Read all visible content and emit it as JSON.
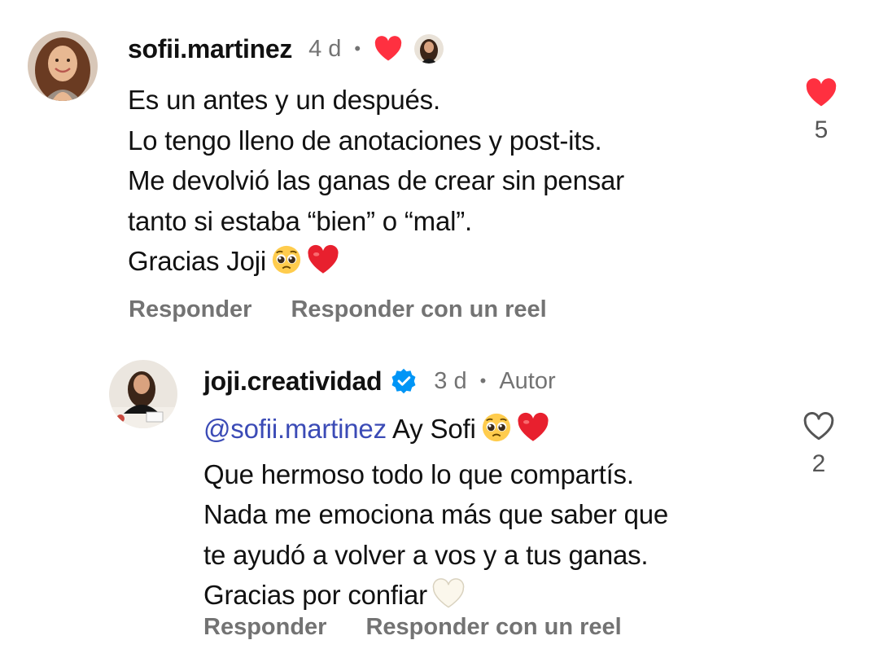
{
  "comments": [
    {
      "username": "sofii.martinez",
      "time": "4 d",
      "lines": [
        "Es un antes y un después.",
        "Lo tengo lleno de anotaciones y post-its.",
        "Me devolvió las ganas de crear sin pensar",
        "tanto si estaba “bien” o “mal”.",
        "Gracias Joji"
      ],
      "like_count": "5",
      "liked": true,
      "actions": [
        "Responder",
        "Responder con un reel"
      ]
    },
    {
      "username": "joji.creatividad",
      "verified": true,
      "time": "3 d",
      "author_badge": "Autor",
      "mention": "@sofii.martinez",
      "first_line_rest": "Ay Sofi",
      "lines": [
        "Que hermoso todo lo que compartís.",
        "Nada me emociona más que saber que",
        "te ayudó a volver a vos y a tus ganas.",
        "Gracias por confiar"
      ],
      "like_count": "2",
      "liked": false,
      "actions": [
        "Responder",
        "Responder con un reel"
      ]
    }
  ],
  "colors": {
    "like_red": "#ff3040",
    "mention_blue": "#3b4bb6",
    "verified_blue": "#0095f6",
    "muted_gray": "#737373"
  },
  "icons": [
    "heart-icon",
    "verified-badge-icon",
    "pleading-face-emoji",
    "red-heart-emoji",
    "white-heart-emoji"
  ]
}
